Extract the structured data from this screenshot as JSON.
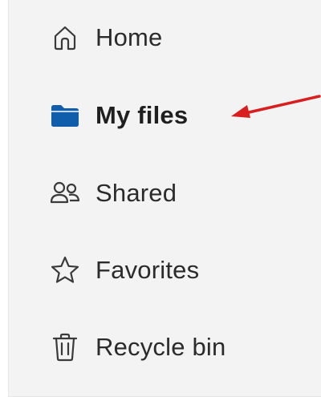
{
  "nav": {
    "items": [
      {
        "label": "Home",
        "icon": "home-icon",
        "active": false
      },
      {
        "label": "My files",
        "icon": "folder-icon",
        "active": true
      },
      {
        "label": "Shared",
        "icon": "people-icon",
        "active": false
      },
      {
        "label": "Favorites",
        "icon": "star-icon",
        "active": false
      },
      {
        "label": "Recycle bin",
        "icon": "trash-icon",
        "active": false
      }
    ]
  },
  "colors": {
    "panel_background": "#f3f3f3",
    "active_icon": "#0f5dab",
    "annotation_arrow": "#d81e1e"
  }
}
